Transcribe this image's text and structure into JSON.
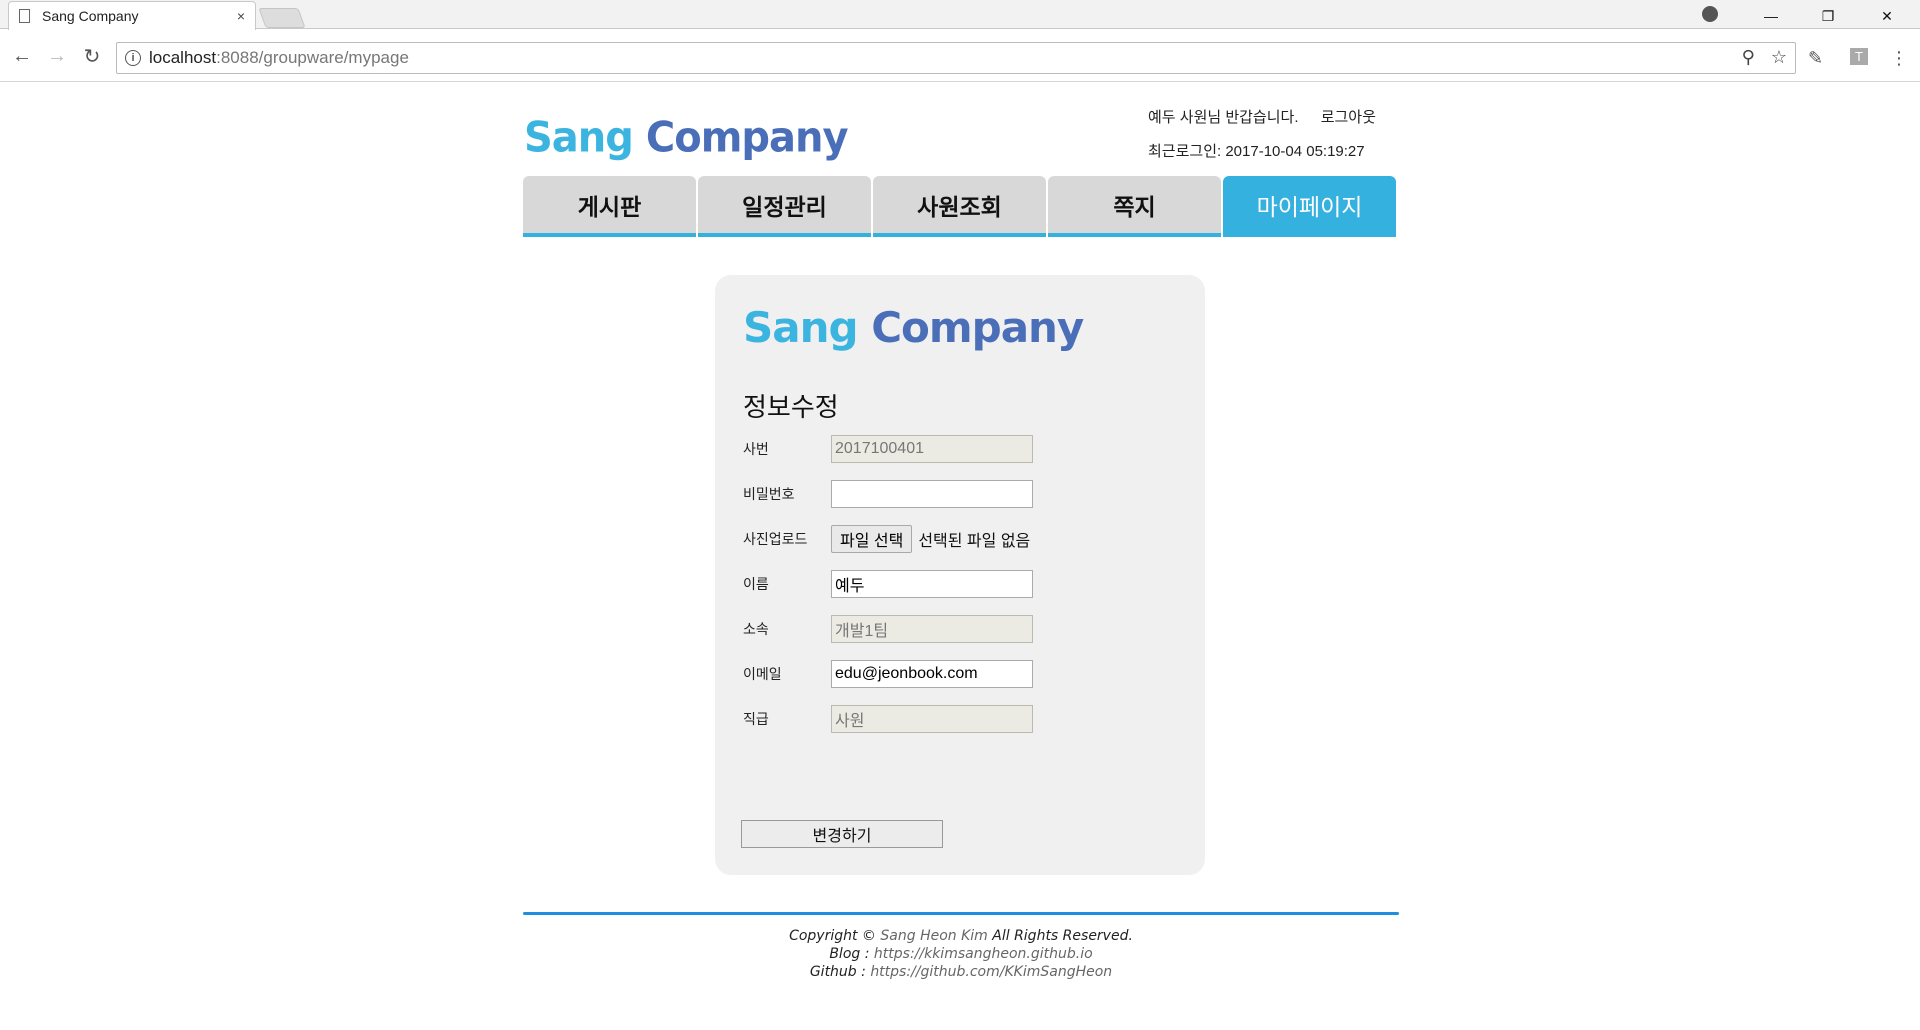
{
  "browser": {
    "tab_title": "Sang Company",
    "tab_close": "×",
    "url_host": "localhost",
    "url_path": ":8088/groupware/mypage",
    "back": "←",
    "forward": "→",
    "reload": "↻",
    "info": "i",
    "key_icon": "⚲",
    "star": "☆",
    "minimize": "—",
    "restore": "❐",
    "close": "✕",
    "menu": "⋮",
    "ext_pen": "✎",
    "ext_t": "T"
  },
  "header": {
    "logo_sang": "Sang",
    "logo_company": "Company",
    "greeting": "예두 사원님 반갑습니다.",
    "logout": "로그아웃",
    "last_login": "최근로그인: 2017-10-04 05:19:27"
  },
  "menu": [
    {
      "label": "게시판"
    },
    {
      "label": "일정관리"
    },
    {
      "label": "사원조회"
    },
    {
      "label": "쪽지"
    },
    {
      "label": "마이페이지"
    }
  ],
  "form": {
    "logo_sang": "Sang",
    "logo_company": "Company",
    "title": "정보수정",
    "fields": {
      "emp_no": {
        "label": "사번",
        "value": "2017100401"
      },
      "password": {
        "label": "비밀번호",
        "value": ""
      },
      "photo": {
        "label": "사진업로드",
        "button": "파일 선택",
        "status": "선택된 파일 없음"
      },
      "name": {
        "label": "이름",
        "value": "예두"
      },
      "dept": {
        "label": "소속",
        "value": "개발1팀"
      },
      "email": {
        "label": "이메일",
        "value": "edu@jeonbook.com"
      },
      "rank": {
        "label": "직급",
        "value": "사원"
      }
    },
    "submit": "변경하기"
  },
  "footer": {
    "copyright_prefix": "Copyright © ",
    "copyright_name": "Sang Heon Kim",
    "copyright_suffix": " All Rights Reserved.",
    "blog_label": "Blog : ",
    "blog_url": "https://kkimsangheon.github.io",
    "github_label": "Github : ",
    "github_url": "https://github.com/KKimSangHeon"
  }
}
